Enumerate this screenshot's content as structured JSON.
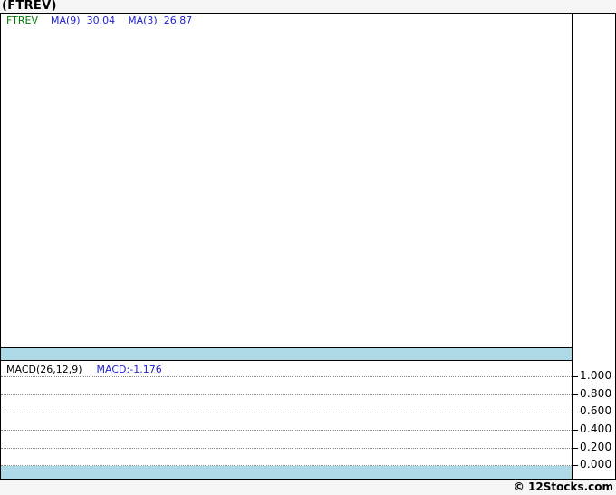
{
  "page": {
    "title": "(FTREV)",
    "footer_credit": "© 12Stocks.com",
    "background": "#f5f5f5"
  },
  "main_chart": {
    "legend": {
      "symbol": "FTREV",
      "ma9_label": "MA(9)",
      "ma9_value": "30.04",
      "ma3_label": "MA(3)",
      "ma3_value": "26.87"
    },
    "colors": {
      "symbol_text": "#007a00",
      "ma_text": "#2222d0",
      "separator_band": "#add8e6"
    }
  },
  "macd_panel": {
    "legend_label": "MACD(26,12,9)",
    "legend_value": "MACD:-1.176",
    "axis_ticks": [
      "1.000",
      "0.800",
      "0.600",
      "0.400",
      "0.200",
      "0.000"
    ]
  },
  "chart_data": [
    {
      "type": "line",
      "title": "(FTREV)",
      "series": [
        {
          "name": "FTREV",
          "color": "#007a00",
          "values": []
        },
        {
          "name": "MA(9)",
          "color": "#2222d0",
          "last_value": 30.04
        },
        {
          "name": "MA(3)",
          "color": "#2222d0",
          "last_value": 26.87
        }
      ],
      "note": "main price panel renders empty/blank in screenshot",
      "grid": false,
      "legend_position": "top-left"
    },
    {
      "type": "line",
      "title": "MACD(26,12,9)",
      "series": [
        {
          "name": "MACD",
          "last_value": -1.176
        }
      ],
      "ylabel": "",
      "ylim": [
        0.0,
        1.0
      ],
      "yticks": [
        1.0,
        0.8,
        0.6,
        0.4,
        0.2,
        0.0
      ],
      "grid": true,
      "note": "dotted horizontal gridlines, y-axis labels on right side; no visible plotted line"
    }
  ]
}
